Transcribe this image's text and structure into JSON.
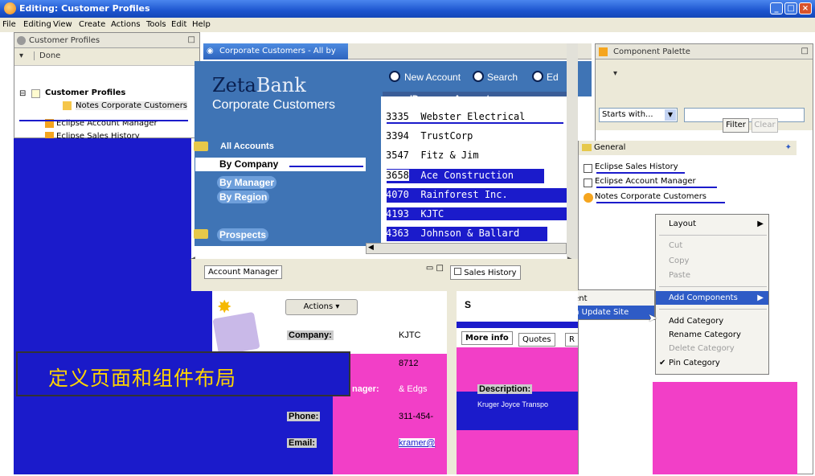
{
  "window": {
    "title": "Editing: Customer Profiles"
  },
  "menu": [
    "File",
    "Editing",
    "View",
    "Create",
    "Actions",
    "Tools",
    "Edit",
    "Help"
  ],
  "left_pane": {
    "title": "Customer Profiles",
    "done": "Done",
    "tree": [
      "Customer Profiles",
      "Notes Corporate Customers",
      "Eclipse Account Manager",
      "Eclipse Sales History"
    ]
  },
  "center_pane": {
    "tab_title": "Corporate Customers - All by",
    "logo_a": "Zeta",
    "logo_b": "Bank",
    "subtitle": "Corporate Customers",
    "new_account": "New Account",
    "search": "Search",
    "ed": "Ed",
    "col_id": "ID",
    "col_account": "Account",
    "nav": {
      "all_accounts": "All Accounts",
      "by_company": "By Company",
      "by_manager": "By Manager",
      "by_region": "By Region",
      "prospects": "Prospects",
      "by_company2": "By Company"
    },
    "rows": [
      {
        "id": "3335",
        "account": "Webster Electrical"
      },
      {
        "id": "3394",
        "account": "TrustCorp"
      },
      {
        "id": "3547",
        "account": "Fitz & Jim"
      },
      {
        "id": "3658",
        "account": "Ace Construction"
      },
      {
        "id": "4070",
        "account": "Rainforest Inc."
      },
      {
        "id": "4193",
        "account": "KJTC"
      },
      {
        "id": "4363",
        "account": "Johnson & Ballard"
      }
    ]
  },
  "palette": {
    "title": "Component Palette",
    "starts_with": "Starts with...",
    "filter": "Filter",
    "clear": "Clear",
    "general": "General",
    "items": [
      "Eclipse Sales History",
      "Eclipse Account Manager",
      "Notes Corporate Customers"
    ]
  },
  "context_menu": {
    "items": [
      "Layout",
      "Cut",
      "Copy",
      "Paste",
      "Add Components",
      "Add Category",
      "Rename Category",
      "Delete Category",
      "Pin Category"
    ],
    "submenu": [
      "Add Domino Component",
      "Add Eclipse View From Update Site"
    ]
  },
  "account_manager": {
    "tab": "Account Manager",
    "actions": "Actions",
    "company_label": "Company:",
    "company_value": "KJTC",
    "number_value": "8712",
    "manager_label": "nager:",
    "manager_value": "Edgs",
    "phone_label": "Phone:",
    "phone_value": "311-454-",
    "email_label": "Email:",
    "email_value": "kramer@"
  },
  "sales_history": {
    "tab": "Sales History",
    "s_letter": "S",
    "more_info": "More info",
    "quotes": "Quotes",
    "r_letter": "R",
    "description_label": "Description:",
    "description_value": "Kruger Joyce Transpo"
  },
  "banner": {
    "text": "定义页面和组件布局"
  },
  "colors": {
    "title_blue": "#1d55cf",
    "panel_blue": "#1b1bcb",
    "magenta": "#f23fc7",
    "selection": "#2e5bc6",
    "banner_text": "#ffd400"
  }
}
